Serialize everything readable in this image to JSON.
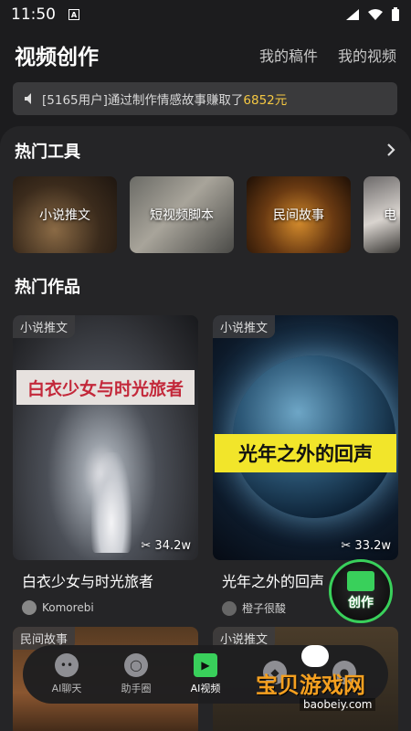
{
  "status_bar": {
    "time": "11:50",
    "a_label": "A"
  },
  "header": {
    "title": "视频创作",
    "links": [
      "我的稿件",
      "我的视频"
    ]
  },
  "notice": {
    "prefix": "[5165用户]通过制作情感故事赚取了",
    "amount": "6852元"
  },
  "hot_tools": {
    "title": "热门工具",
    "items": [
      {
        "label": "小说推文"
      },
      {
        "label": "短视频脚本"
      },
      {
        "label": "民间故事"
      },
      {
        "label": "电"
      }
    ]
  },
  "hot_works": {
    "title": "热门作品",
    "cards": [
      {
        "badge": "小说推文",
        "banner": "白衣少女与时光旅者",
        "views": "34.2w",
        "title": "白衣少女与时光旅者",
        "author": "Komorebi"
      },
      {
        "badge": "小说推文",
        "banner": "光年之外的回声",
        "views": "33.2w",
        "title": "光年之外的回声",
        "author": "橙子很酸"
      }
    ],
    "row2_badges": [
      "民间故事",
      "小说推文"
    ]
  },
  "fab": {
    "label": "创作"
  },
  "tabbar": {
    "tabs": [
      {
        "label": "AI聊天",
        "icon": "chat-face-icon"
      },
      {
        "label": "助手圈",
        "icon": "circle-icon"
      },
      {
        "label": "AI视频",
        "icon": "play-icon"
      },
      {
        "label": "",
        "icon": "cube-icon"
      },
      {
        "label": "",
        "icon": "profile-icon"
      }
    ]
  },
  "watermark": {
    "text": "宝贝游戏网",
    "url": "baobeiy.com"
  }
}
